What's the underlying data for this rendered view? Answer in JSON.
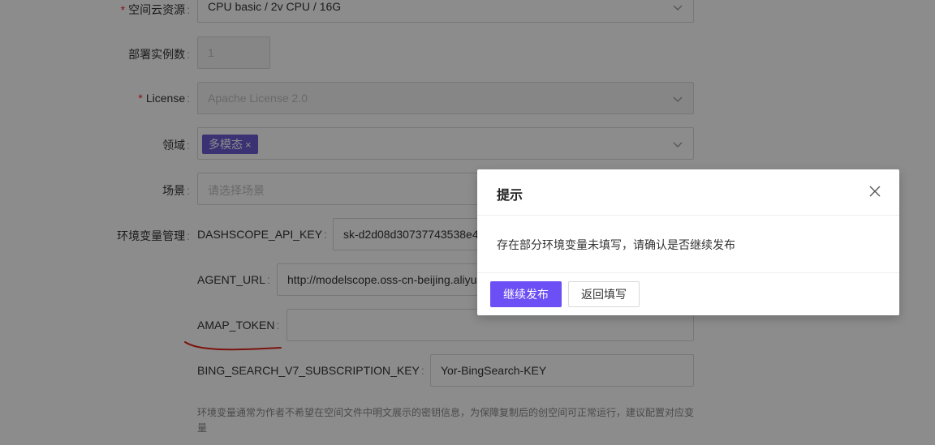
{
  "form": {
    "space_resource": {
      "label": "空间云资源",
      "value": "CPU basic / 2v CPU / 16G"
    },
    "instance_count": {
      "label": "部署实例数",
      "value": "1"
    },
    "license": {
      "label": "License",
      "value": "Apache License 2.0"
    },
    "domain": {
      "label": "领域",
      "tag": "多模态",
      "tag_close": "×"
    },
    "scene": {
      "label": "场景",
      "placeholder": "请选择场景"
    },
    "env": {
      "label": "环境变量管理",
      "items": [
        {
          "key": "DASHSCOPE_API_KEY",
          "value": "sk-d2d08d30737743538e4"
        },
        {
          "key": "AGENT_URL",
          "value": "http://modelscope.oss-cn-beijing.aliyu"
        },
        {
          "key": "AMAP_TOKEN",
          "value": ""
        },
        {
          "key": "BING_SEARCH_V7_SUBSCRIPTION_KEY",
          "value": "Yor-BingSearch-KEY"
        }
      ],
      "hint": "环境变量通常为作者不希望在空间文件中明文展示的密钥信息，为保障复制后的创空间可正常运行，建议配置对应变量"
    },
    "colon": ":",
    "required_mark": "*"
  },
  "modal": {
    "title": "提示",
    "message": "存在部分环境变量未填写，请确认是否继续发布",
    "confirm_label": "继续发布",
    "cancel_label": "返回填写"
  },
  "colors": {
    "primary": "#6c4ff5",
    "tag": "#6c5cd4",
    "annotation": "#e0241b"
  },
  "icons": [
    "chevron-down-icon",
    "close-icon"
  ]
}
